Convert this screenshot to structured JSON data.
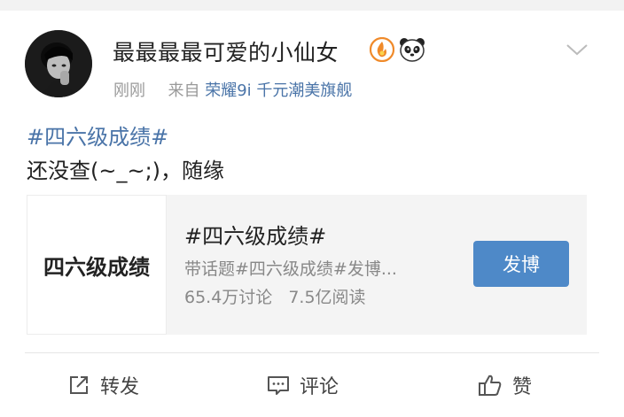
{
  "post": {
    "username": "最最最最可爱的小仙女",
    "time": "刚刚",
    "from_label": "来自",
    "source": "荣耀9i 千元潮美旗舰",
    "topic_tag": "#四六级成绩#",
    "text": "还没查(~_~;)，随缘"
  },
  "card": {
    "thumb_text": "四六级成绩",
    "title": "#四六级成绩#",
    "description": "带话题#四六级成绩#发博...",
    "discussions": "65.4万讨论",
    "reads": "7.5亿阅读",
    "post_button": "发博"
  },
  "actions": {
    "repost": "转发",
    "comment": "评论",
    "like": "赞"
  },
  "colors": {
    "link": "#4a74a8",
    "button": "#4e89c8",
    "meta_text": "#999999"
  }
}
